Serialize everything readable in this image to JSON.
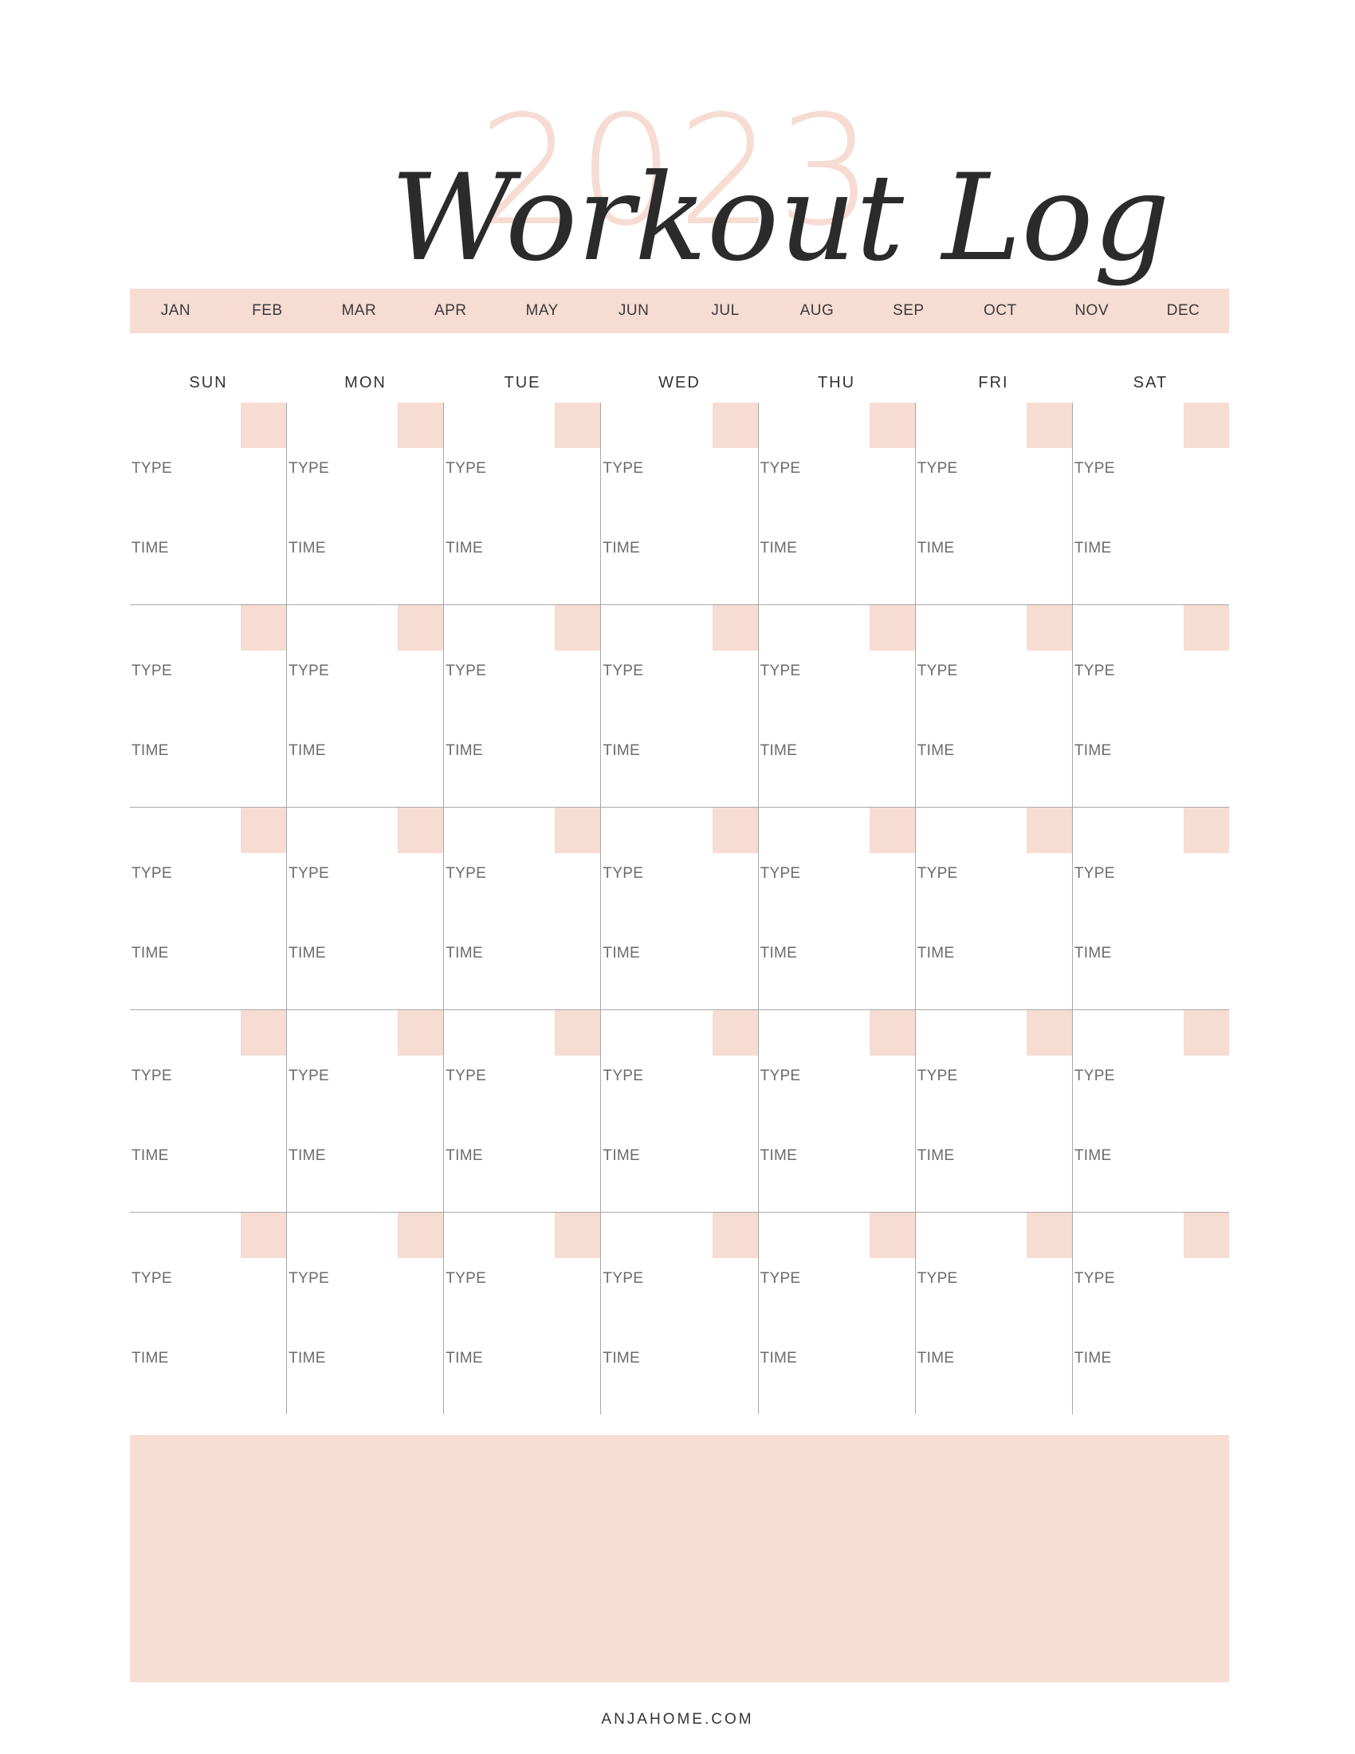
{
  "header": {
    "year": "2023",
    "title": "Workout Log"
  },
  "months": [
    "JAN",
    "FEB",
    "MAR",
    "APR",
    "MAY",
    "JUN",
    "JUL",
    "AUG",
    "SEP",
    "OCT",
    "NOV",
    "DEC"
  ],
  "weekdays": [
    "SUN",
    "MON",
    "TUE",
    "WED",
    "THU",
    "FRI",
    "SAT"
  ],
  "cell_labels": {
    "type": "TYPE",
    "time": "TIME"
  },
  "footer": {
    "site": "ANJAHOME.COM"
  },
  "colors": {
    "accent": "#f6dcd3",
    "grid_line": "#a8a8a8",
    "text": "#3a3a3a"
  },
  "week_count": 5
}
